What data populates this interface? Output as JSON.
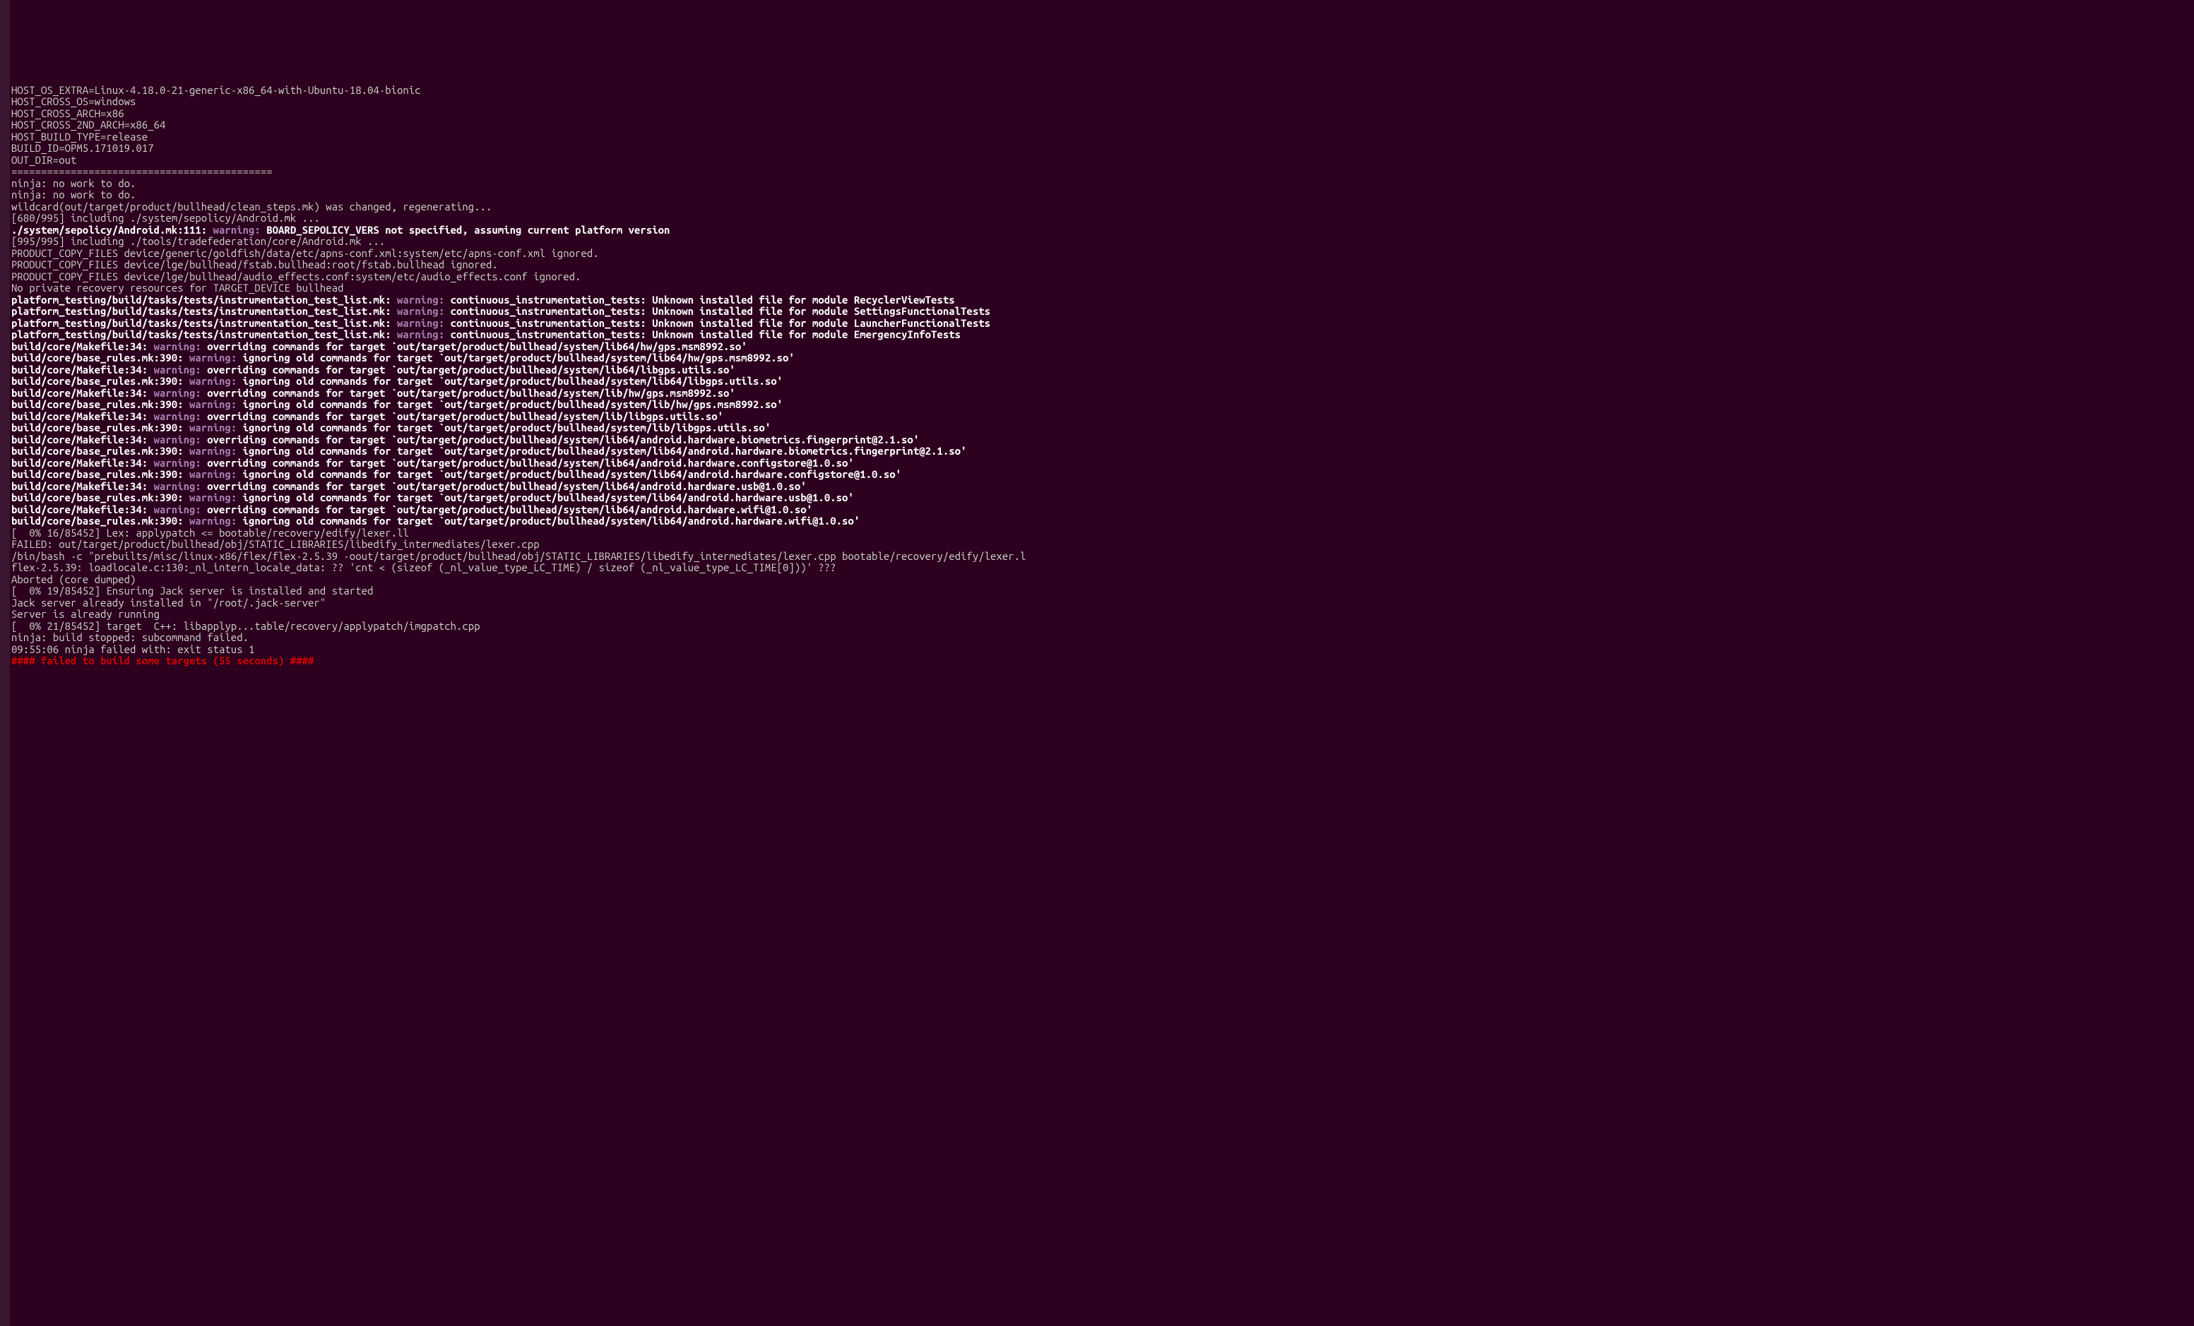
{
  "lines": [
    {
      "segs": [
        {
          "cls": "plain",
          "t": "HOST_OS_EXTRA=Linux-4.18.0-21-generic-x86_64-with-Ubuntu-18.04-bionic"
        }
      ]
    },
    {
      "segs": [
        {
          "cls": "plain",
          "t": "HOST_CROSS_OS=windows"
        }
      ]
    },
    {
      "segs": [
        {
          "cls": "plain",
          "t": "HOST_CROSS_ARCH=x86"
        }
      ]
    },
    {
      "segs": [
        {
          "cls": "plain",
          "t": "HOST_CROSS_2ND_ARCH=x86_64"
        }
      ]
    },
    {
      "segs": [
        {
          "cls": "plain",
          "t": "HOST_BUILD_TYPE=release"
        }
      ]
    },
    {
      "segs": [
        {
          "cls": "plain",
          "t": "BUILD_ID=OPM5.171019.017"
        }
      ]
    },
    {
      "segs": [
        {
          "cls": "plain",
          "t": "OUT_DIR=out"
        }
      ]
    },
    {
      "segs": [
        {
          "cls": "plain",
          "t": "============================================"
        }
      ]
    },
    {
      "segs": [
        {
          "cls": "plain",
          "t": "ninja: no work to do."
        }
      ]
    },
    {
      "segs": [
        {
          "cls": "plain",
          "t": "ninja: no work to do."
        }
      ]
    },
    {
      "segs": [
        {
          "cls": "plain",
          "t": "wildcard(out/target/product/bullhead/clean_steps.mk) was changed, regenerating..."
        }
      ]
    },
    {
      "segs": [
        {
          "cls": "plain",
          "t": "[680/995] including ./system/sepolicy/Android.mk ..."
        }
      ]
    },
    {
      "segs": [
        {
          "cls": "bold",
          "t": "./system/sepolicy/Android.mk:111: "
        },
        {
          "cls": "warning",
          "t": "warning: "
        },
        {
          "cls": "bold",
          "t": "BOARD_SEPOLICY_VERS not specified, assuming current platform version"
        }
      ]
    },
    {
      "segs": [
        {
          "cls": "plain",
          "t": "[995/995] including ./tools/tradefederation/core/Android.mk ..."
        }
      ]
    },
    {
      "segs": [
        {
          "cls": "plain",
          "t": "PRODUCT_COPY_FILES device/generic/goldfish/data/etc/apns-conf.xml:system/etc/apns-conf.xml ignored."
        }
      ]
    },
    {
      "segs": [
        {
          "cls": "plain",
          "t": "PRODUCT_COPY_FILES device/lge/bullhead/fstab.bullhead:root/fstab.bullhead ignored."
        }
      ]
    },
    {
      "segs": [
        {
          "cls": "plain",
          "t": "PRODUCT_COPY_FILES device/lge/bullhead/audio_effects.conf:system/etc/audio_effects.conf ignored."
        }
      ]
    },
    {
      "segs": [
        {
          "cls": "plain",
          "t": "No private recovery resources for TARGET_DEVICE bullhead"
        }
      ]
    },
    {
      "segs": [
        {
          "cls": "bold",
          "t": "platform_testing/build/tasks/tests/instrumentation_test_list.mk: "
        },
        {
          "cls": "warning",
          "t": "warning: "
        },
        {
          "cls": "bold",
          "t": "continuous_instrumentation_tests: Unknown installed file for module RecyclerViewTests"
        }
      ]
    },
    {
      "segs": [
        {
          "cls": "bold",
          "t": "platform_testing/build/tasks/tests/instrumentation_test_list.mk: "
        },
        {
          "cls": "warning",
          "t": "warning: "
        },
        {
          "cls": "bold",
          "t": "continuous_instrumentation_tests: Unknown installed file for module SettingsFunctionalTests"
        }
      ]
    },
    {
      "segs": [
        {
          "cls": "bold",
          "t": "platform_testing/build/tasks/tests/instrumentation_test_list.mk: "
        },
        {
          "cls": "warning",
          "t": "warning: "
        },
        {
          "cls": "bold",
          "t": "continuous_instrumentation_tests: Unknown installed file for module LauncherFunctionalTests"
        }
      ]
    },
    {
      "segs": [
        {
          "cls": "bold",
          "t": "platform_testing/build/tasks/tests/instrumentation_test_list.mk: "
        },
        {
          "cls": "warning",
          "t": "warning: "
        },
        {
          "cls": "bold",
          "t": "continuous_instrumentation_tests: Unknown installed file for module EmergencyInfoTests"
        }
      ]
    },
    {
      "segs": [
        {
          "cls": "bold",
          "t": "build/core/Makefile:34: "
        },
        {
          "cls": "warning",
          "t": "warning: "
        },
        {
          "cls": "bold",
          "t": "overriding commands for target `out/target/product/bullhead/system/lib64/hw/gps.msm8992.so'"
        }
      ]
    },
    {
      "segs": [
        {
          "cls": "bold",
          "t": "build/core/base_rules.mk:390: "
        },
        {
          "cls": "warning",
          "t": "warning: "
        },
        {
          "cls": "bold",
          "t": "ignoring old commands for target `out/target/product/bullhead/system/lib64/hw/gps.msm8992.so'"
        }
      ]
    },
    {
      "segs": [
        {
          "cls": "bold",
          "t": "build/core/Makefile:34: "
        },
        {
          "cls": "warning",
          "t": "warning: "
        },
        {
          "cls": "bold",
          "t": "overriding commands for target `out/target/product/bullhead/system/lib64/libgps.utils.so'"
        }
      ]
    },
    {
      "segs": [
        {
          "cls": "bold",
          "t": "build/core/base_rules.mk:390: "
        },
        {
          "cls": "warning",
          "t": "warning: "
        },
        {
          "cls": "bold",
          "t": "ignoring old commands for target `out/target/product/bullhead/system/lib64/libgps.utils.so'"
        }
      ]
    },
    {
      "segs": [
        {
          "cls": "bold",
          "t": "build/core/Makefile:34: "
        },
        {
          "cls": "warning",
          "t": "warning: "
        },
        {
          "cls": "bold",
          "t": "overriding commands for target `out/target/product/bullhead/system/lib/hw/gps.msm8992.so'"
        }
      ]
    },
    {
      "segs": [
        {
          "cls": "bold",
          "t": "build/core/base_rules.mk:390: "
        },
        {
          "cls": "warning",
          "t": "warning: "
        },
        {
          "cls": "bold",
          "t": "ignoring old commands for target `out/target/product/bullhead/system/lib/hw/gps.msm8992.so'"
        }
      ]
    },
    {
      "segs": [
        {
          "cls": "bold",
          "t": "build/core/Makefile:34: "
        },
        {
          "cls": "warning",
          "t": "warning: "
        },
        {
          "cls": "bold",
          "t": "overriding commands for target `out/target/product/bullhead/system/lib/libgps.utils.so'"
        }
      ]
    },
    {
      "segs": [
        {
          "cls": "bold",
          "t": "build/core/base_rules.mk:390: "
        },
        {
          "cls": "warning",
          "t": "warning: "
        },
        {
          "cls": "bold",
          "t": "ignoring old commands for target `out/target/product/bullhead/system/lib/libgps.utils.so'"
        }
      ]
    },
    {
      "segs": [
        {
          "cls": "bold",
          "t": "build/core/Makefile:34: "
        },
        {
          "cls": "warning",
          "t": "warning: "
        },
        {
          "cls": "bold",
          "t": "overriding commands for target `out/target/product/bullhead/system/lib64/android.hardware.biometrics.fingerprint@2.1.so'"
        }
      ]
    },
    {
      "segs": [
        {
          "cls": "bold",
          "t": "build/core/base_rules.mk:390: "
        },
        {
          "cls": "warning",
          "t": "warning: "
        },
        {
          "cls": "bold",
          "t": "ignoring old commands for target `out/target/product/bullhead/system/lib64/android.hardware.biometrics.fingerprint@2.1.so'"
        }
      ]
    },
    {
      "segs": [
        {
          "cls": "bold",
          "t": "build/core/Makefile:34: "
        },
        {
          "cls": "warning",
          "t": "warning: "
        },
        {
          "cls": "bold",
          "t": "overriding commands for target `out/target/product/bullhead/system/lib64/android.hardware.configstore@1.0.so'"
        }
      ]
    },
    {
      "segs": [
        {
          "cls": "bold",
          "t": "build/core/base_rules.mk:390: "
        },
        {
          "cls": "warning",
          "t": "warning: "
        },
        {
          "cls": "bold",
          "t": "ignoring old commands for target `out/target/product/bullhead/system/lib64/android.hardware.configstore@1.0.so'"
        }
      ]
    },
    {
      "segs": [
        {
          "cls": "bold",
          "t": "build/core/Makefile:34: "
        },
        {
          "cls": "warning",
          "t": "warning: "
        },
        {
          "cls": "bold",
          "t": "overriding commands for target `out/target/product/bullhead/system/lib64/android.hardware.usb@1.0.so'"
        }
      ]
    },
    {
      "segs": [
        {
          "cls": "bold",
          "t": "build/core/base_rules.mk:390: "
        },
        {
          "cls": "warning",
          "t": "warning: "
        },
        {
          "cls": "bold",
          "t": "ignoring old commands for target `out/target/product/bullhead/system/lib64/android.hardware.usb@1.0.so'"
        }
      ]
    },
    {
      "segs": [
        {
          "cls": "bold",
          "t": "build/core/Makefile:34: "
        },
        {
          "cls": "warning",
          "t": "warning: "
        },
        {
          "cls": "bold",
          "t": "overriding commands for target `out/target/product/bullhead/system/lib64/android.hardware.wifi@1.0.so'"
        }
      ]
    },
    {
      "segs": [
        {
          "cls": "bold",
          "t": "build/core/base_rules.mk:390: "
        },
        {
          "cls": "warning",
          "t": "warning: "
        },
        {
          "cls": "bold",
          "t": "ignoring old commands for target `out/target/product/bullhead/system/lib64/android.hardware.wifi@1.0.so'"
        }
      ]
    },
    {
      "segs": [
        {
          "cls": "plain",
          "t": "[  0% 16/85452] Lex: applypatch <= bootable/recovery/edify/lexer.ll"
        }
      ]
    },
    {
      "segs": [
        {
          "cls": "plain",
          "t": "FAILED: out/target/product/bullhead/obj/STATIC_LIBRARIES/libedify_intermediates/lexer.cpp"
        }
      ]
    },
    {
      "segs": [
        {
          "cls": "plain",
          "t": "/bin/bash -c \"prebuilts/misc/linux-x86/flex/flex-2.5.39 -oout/target/product/bullhead/obj/STATIC_LIBRARIES/libedify_intermediates/lexer.cpp bootable/recovery/edify/lexer.l"
        }
      ]
    },
    {
      "segs": [
        {
          "cls": "plain",
          "t": "flex-2.5.39: loadlocale.c:130:_nl_intern_locale_data: ?? 'cnt < (sizeof (_nl_value_type_LC_TIME) / sizeof (_nl_value_type_LC_TIME[0]))' ???"
        }
      ]
    },
    {
      "segs": [
        {
          "cls": "plain",
          "t": "Aborted (core dumped)"
        }
      ]
    },
    {
      "segs": [
        {
          "cls": "plain",
          "t": "[  0% 19/85452] Ensuring Jack server is installed and started"
        }
      ]
    },
    {
      "segs": [
        {
          "cls": "plain",
          "t": "Jack server already installed in \"/root/.jack-server\""
        }
      ]
    },
    {
      "segs": [
        {
          "cls": "plain",
          "t": "Server is already running"
        }
      ]
    },
    {
      "segs": [
        {
          "cls": "plain",
          "t": "[  0% 21/85452] target  C++: libapplyp...table/recovery/applypatch/imgpatch.cpp"
        }
      ]
    },
    {
      "segs": [
        {
          "cls": "plain",
          "t": "ninja: build stopped: subcommand failed."
        }
      ]
    },
    {
      "segs": [
        {
          "cls": "plain",
          "t": "09:55:06 ninja failed with: exit status 1"
        }
      ]
    },
    {
      "segs": [
        {
          "cls": "plain",
          "t": ""
        }
      ]
    },
    {
      "segs": [
        {
          "cls": "failedred",
          "t": "#### failed to build some targets (55 seconds) ####"
        }
      ]
    },
    {
      "segs": [
        {
          "cls": "plain",
          "t": ""
        }
      ]
    }
  ]
}
